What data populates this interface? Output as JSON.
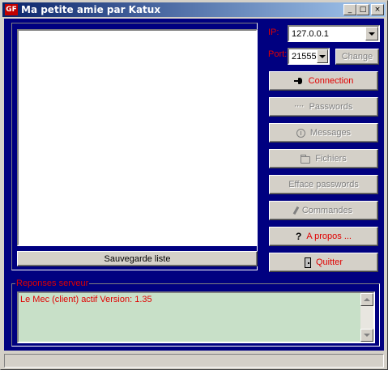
{
  "window": {
    "icon_text": "GF",
    "title": "Ma petite amie par Katux",
    "minimize": "_",
    "maximize": "□",
    "close": "×"
  },
  "connection": {
    "ip_label": "IP:",
    "ip_value": "127.0.0.1",
    "port_label": "Port:",
    "port_value": "21555",
    "change_label": "Change"
  },
  "buttons": {
    "connection": "Connection",
    "passwords": "Passwords",
    "messages": "Messages",
    "fichiers": "Fichiers",
    "efface_passwords": "Efface passwords",
    "commandes": "Commandes",
    "apropos": "A propos ...",
    "quitter": "Quitter",
    "save_list": "Sauvegarde liste"
  },
  "responses": {
    "title": "Reponses serveur",
    "lines": [
      "Le Mec (client) actif Version: 1.35"
    ]
  },
  "colors": {
    "background": "#000080",
    "accent_text": "#e00000",
    "response_bg": "#c8e0c8"
  }
}
